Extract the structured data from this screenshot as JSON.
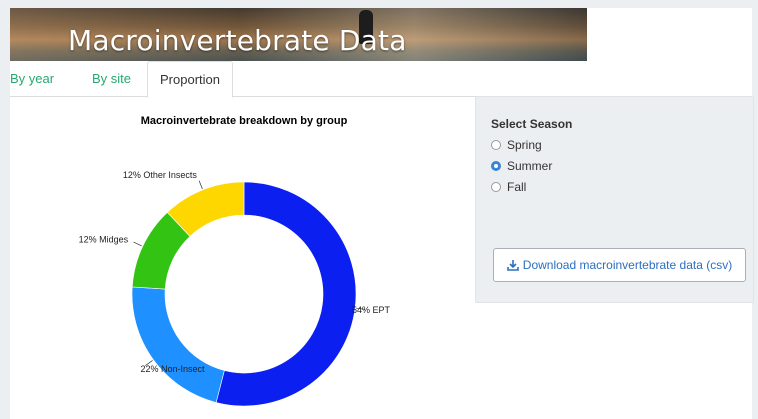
{
  "header": {
    "title": "Macroinvertebrate Data"
  },
  "tabs": [
    {
      "label": "By year"
    },
    {
      "label": "By site"
    },
    {
      "label": "Proportion",
      "active": true
    }
  ],
  "sidebar": {
    "season_label": "Select Season",
    "seasons": [
      {
        "label": "Spring",
        "selected": false
      },
      {
        "label": "Summer",
        "selected": true
      },
      {
        "label": "Fall",
        "selected": false
      }
    ],
    "download_label": "Download macroinvertebrate data (csv)",
    "download_icon": "download-icon",
    "accent_color": "#3a85d8"
  },
  "chart_data": {
    "type": "pie",
    "title": "Macroinvertebrate breakdown by group",
    "donut": true,
    "categories": [
      "EPT",
      "Non-Insect",
      "Midges",
      "Other Insects"
    ],
    "values": [
      54,
      22,
      12,
      12
    ],
    "labels": [
      "54% EPT",
      "22% Non-Insect",
      "12% Midges",
      "12% Other Insects"
    ],
    "colors": [
      "#0a1ff0",
      "#1e90ff",
      "#33c313",
      "#ffd700"
    ]
  }
}
